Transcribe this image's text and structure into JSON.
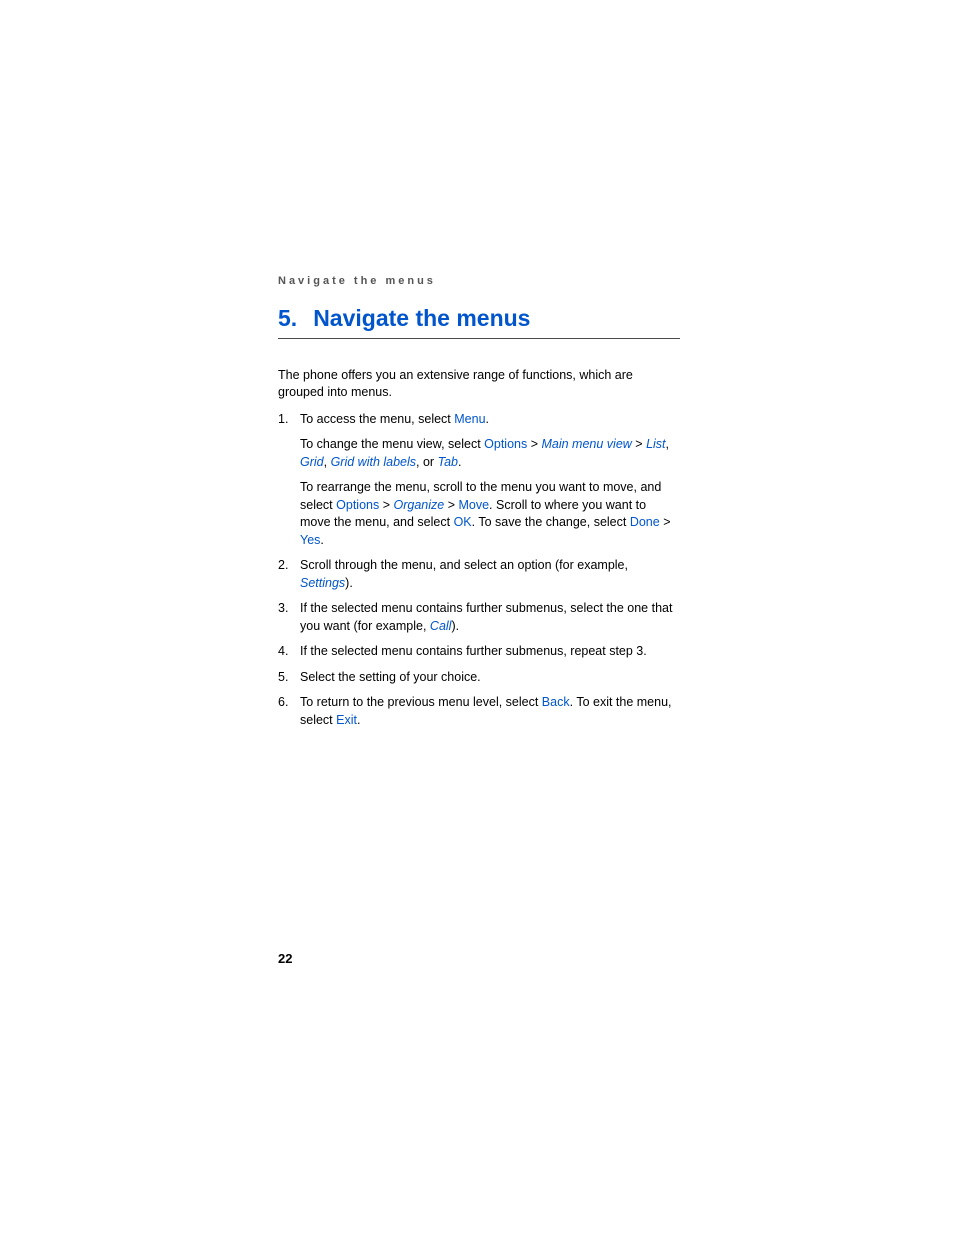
{
  "header": {
    "running": "Navigate the menus"
  },
  "chapter": {
    "number": "5.",
    "title": "Navigate the menus"
  },
  "intro": "The phone offers you an extensive range of functions, which are grouped into menus.",
  "steps": {
    "s1": {
      "num": "1.",
      "t1a": "To access the menu, select ",
      "kMenu": "Menu",
      "t1b": ".",
      "t2a": "To change the menu view, select ",
      "kOptions": "Options",
      "sep_gt": " > ",
      "kMainMenuView": "Main menu view",
      "kList": "List",
      "comma": ", ",
      "kGrid": "Grid",
      "kGridLabels": "Grid with labels",
      "or": ", or ",
      "kTab": "Tab",
      "period": ".",
      "t3a": "To rearrange the menu, scroll to the menu you want to move, and select ",
      "kOrganize": "Organize",
      "kMove": "Move",
      "t3b": ". Scroll to where you want to move the menu, and select ",
      "kOK": "OK",
      "t3c": ". To save the change, select ",
      "kDone": "Done",
      "kYes": "Yes"
    },
    "s2": {
      "num": "2.",
      "ta": "Scroll through the menu, and select an option (for example, ",
      "kSettings": "Settings",
      "tb": ")."
    },
    "s3": {
      "num": "3.",
      "ta": "If the selected menu contains further submenus, select the one that you want (for example, ",
      "kCall": "Call",
      "tb": ")."
    },
    "s4": {
      "num": "4.",
      "t": "If the selected menu contains further submenus, repeat step 3."
    },
    "s5": {
      "num": "5.",
      "t": "Select the setting of your choice."
    },
    "s6": {
      "num": "6.",
      "ta": "To return to the previous menu level, select ",
      "kBack": "Back",
      "tb": ". To exit the menu, select ",
      "kExit": "Exit",
      "tc": "."
    }
  },
  "pageNumber": "22"
}
